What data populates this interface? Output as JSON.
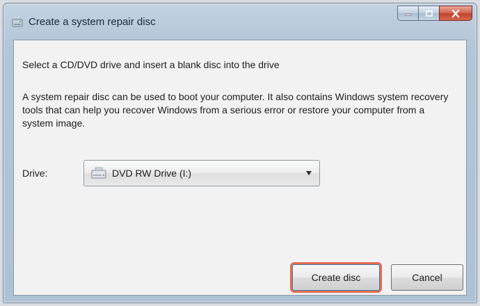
{
  "window": {
    "title": "Create a system repair disc",
    "icon": "disc-drive-icon",
    "caption_buttons": [
      "minimize",
      "maximize",
      "close"
    ]
  },
  "content": {
    "heading": "Select a CD/DVD drive and insert a blank disc into the drive",
    "description": "A system repair disc can be used to boot your computer. It also contains Windows system recovery tools that can help you recover Windows from a serious error or restore your computer from a system image.",
    "drive_label": "Drive:",
    "drive_selected": "DVD RW Drive (I:)"
  },
  "buttons": {
    "create": "Create disc",
    "cancel": "Cancel"
  },
  "colors": {
    "highlight_outline": "#e36b4f",
    "close_button": "#c1412a"
  }
}
